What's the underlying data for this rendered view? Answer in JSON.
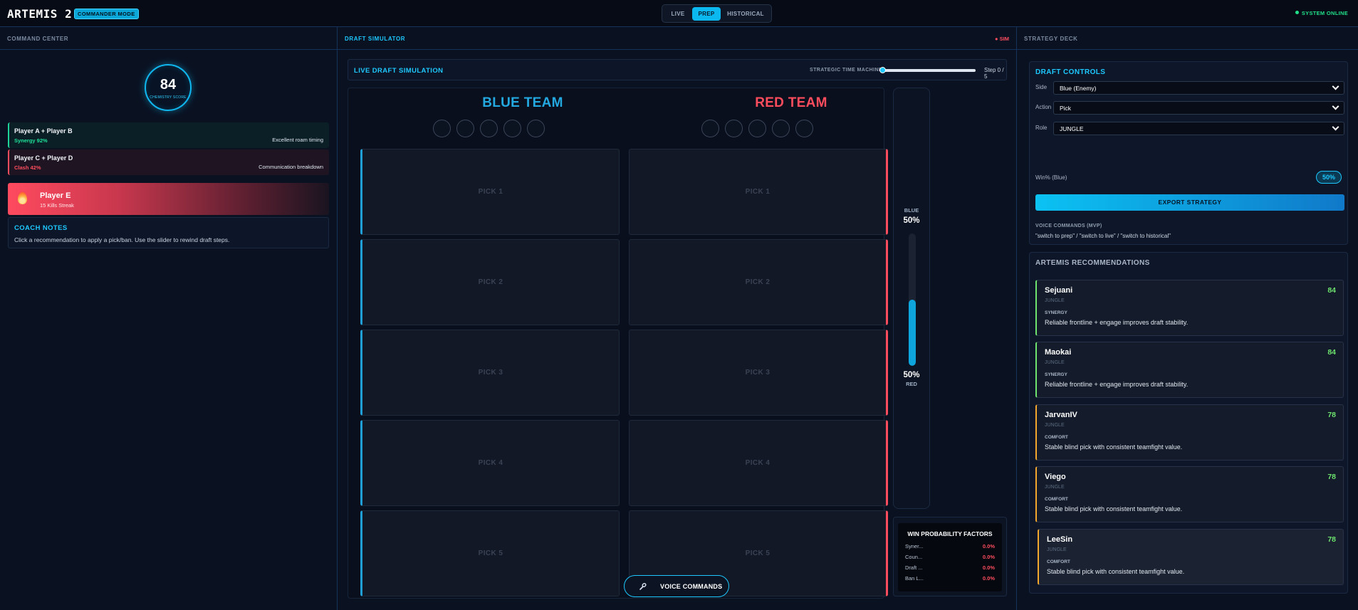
{
  "header": {
    "app_title": "ARTEMIS 2.0",
    "mode_badge": "COMMANDER MODE",
    "tabs": [
      {
        "label": "LIVE",
        "active": false
      },
      {
        "label": "PREP",
        "active": true
      },
      {
        "label": "HISTORICAL",
        "active": false
      }
    ],
    "system_status": "SYSTEM ONLINE",
    "accent_color": "#0bb8ef"
  },
  "command_center": {
    "header": "COMMAND CENTER",
    "chemistry_score": "84",
    "chemistry_label": "CHEMISTRY SCORE",
    "pairs": [
      {
        "players": "Player A + Player B",
        "stat": "Synergy 92%",
        "note": "Excellent roam timing",
        "kind": "synergy",
        "color": "#1fe39a"
      },
      {
        "players": "Player C + Player D",
        "stat": "Clash 42%",
        "note": "Communication breakdown",
        "kind": "clash",
        "color": "#ff4d5e"
      }
    ],
    "streak": {
      "player": "Player E",
      "detail": "15 Kills Streak",
      "icon": "flame-icon"
    },
    "coach_notes": {
      "title": "COACH NOTES",
      "text": "Click a recommendation to apply a pick/ban. Use the slider to rewind draft steps."
    }
  },
  "draft": {
    "header": "DRAFT SIMULATOR",
    "sim_tag": "● SIM",
    "bar_title": "LIVE DRAFT SIMULATION",
    "time_machine_label": "STRATEGIC TIME MACHINE",
    "time_machine_step": 0,
    "time_machine_max": 5,
    "step_text": "Step 0 / 5",
    "blue_team": "BLUE TEAM",
    "red_team": "RED TEAM",
    "blue_picks": [
      "PICK 1",
      "PICK 2",
      "PICK 3",
      "PICK 4",
      "PICK 5"
    ],
    "red_picks": [
      "PICK 1",
      "PICK 2",
      "PICK 3",
      "PICK 4",
      "PICK 5"
    ],
    "ban_slots_per_team": 5,
    "win_bar": {
      "blue_label": "BLUE",
      "blue_value": "50%",
      "red_value": "50%",
      "red_label": "RED",
      "blue_fraction": 0.5
    },
    "factors": {
      "title": "WIN PROBABILITY FACTORS",
      "rows": [
        {
          "name": "Syner...",
          "value": "0.0%"
        },
        {
          "name": "Coun...",
          "value": "0.0%"
        },
        {
          "name": "Draft ...",
          "value": "0.0%"
        },
        {
          "name": "Ban L...",
          "value": "0.0%"
        }
      ]
    },
    "voice_button": "VOICE COMMANDS"
  },
  "strategy_deck": {
    "header": "STRATEGY DECK",
    "controls_title": "DRAFT CONTROLS",
    "side_label": "Side",
    "side_value": "Blue (Enemy)",
    "action_label": "Action",
    "action_value": "Pick",
    "role_label": "Role",
    "role_value": "JUNGLE",
    "winpct_label": "Win% (Blue)",
    "winpct_value": "50%",
    "export_button": "EXPORT STRATEGY",
    "voice_title": "VOICE COMMANDS (MVP)",
    "voice_help": "\"switch to prep\" / \"switch to live\" / \"switch to historical\"",
    "recs_title": "ARTEMIS RECOMMENDATIONS",
    "recommendations": [
      {
        "name": "Sejuani",
        "score": "84",
        "role": "JUNGLE",
        "tag": "SYNERGY",
        "reason": "Reliable frontline + engage improves draft stability.",
        "accent": "green"
      },
      {
        "name": "Maokai",
        "score": "84",
        "role": "JUNGLE",
        "tag": "SYNERGY",
        "reason": "Reliable frontline + engage improves draft stability.",
        "accent": "green"
      },
      {
        "name": "JarvanIV",
        "score": "78",
        "role": "JUNGLE",
        "tag": "COMFORT",
        "reason": "Stable blind pick with consistent teamfight value.",
        "accent": "orange"
      },
      {
        "name": "Viego",
        "score": "78",
        "role": "JUNGLE",
        "tag": "COMFORT",
        "reason": "Stable blind pick with consistent teamfight value.",
        "accent": "orange"
      },
      {
        "name": "LeeSin",
        "score": "78",
        "role": "JUNGLE",
        "tag": "COMFORT",
        "reason": "Stable blind pick with consistent teamfight value.",
        "accent": "orange"
      }
    ]
  }
}
